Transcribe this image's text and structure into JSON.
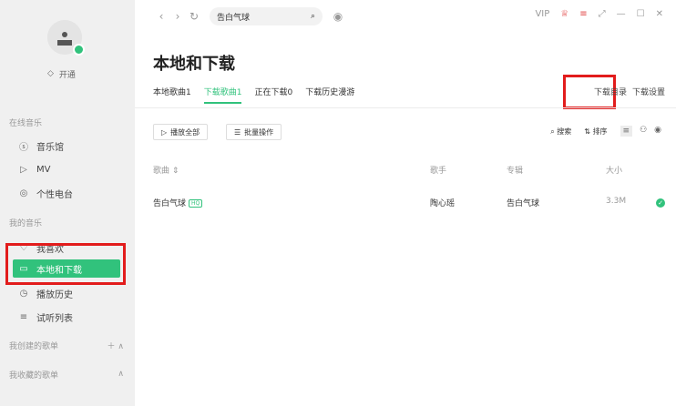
{
  "sidebar": {
    "vip_label": "开通",
    "section_online": "在线音乐",
    "section_mine": "我的音乐",
    "items": [
      {
        "label": "音乐馆",
        "icon": "music-hall-icon"
      },
      {
        "label": "MV",
        "icon": "mv-icon"
      },
      {
        "label": "个性电台",
        "icon": "radio-icon"
      },
      {
        "label": "我喜欢",
        "icon": "heart-icon"
      },
      {
        "label": "本地和下载",
        "icon": "monitor-icon"
      },
      {
        "label": "播放历史",
        "icon": "clock-icon"
      },
      {
        "label": "试听列表",
        "icon": "playlist-icon"
      }
    ],
    "created_playlists": "我创建的歌单",
    "collected_playlists": "我收藏的歌单"
  },
  "topbar": {
    "search_value": "告白气球",
    "vip": "VIP"
  },
  "main": {
    "title": "本地和下载",
    "tabs": [
      "本地歌曲1",
      "下载歌曲1",
      "正在下载0",
      "下载历史漫游"
    ],
    "active_tab": 1,
    "right_links": [
      "下载目录",
      "下载设置"
    ],
    "play_all": "播放全部",
    "batch": "批量操作",
    "search": "搜索",
    "sort": "排序"
  },
  "table": {
    "headers": [
      "歌曲",
      "歌手",
      "专辑",
      "大小"
    ],
    "rows": [
      {
        "song": "告白气球",
        "badge": "HQ",
        "artist": "陶心瑶",
        "album": "告白气球",
        "size": "3.3M"
      }
    ]
  },
  "colors": {
    "accent": "#31c27c",
    "highlight": "#e21c1c"
  }
}
